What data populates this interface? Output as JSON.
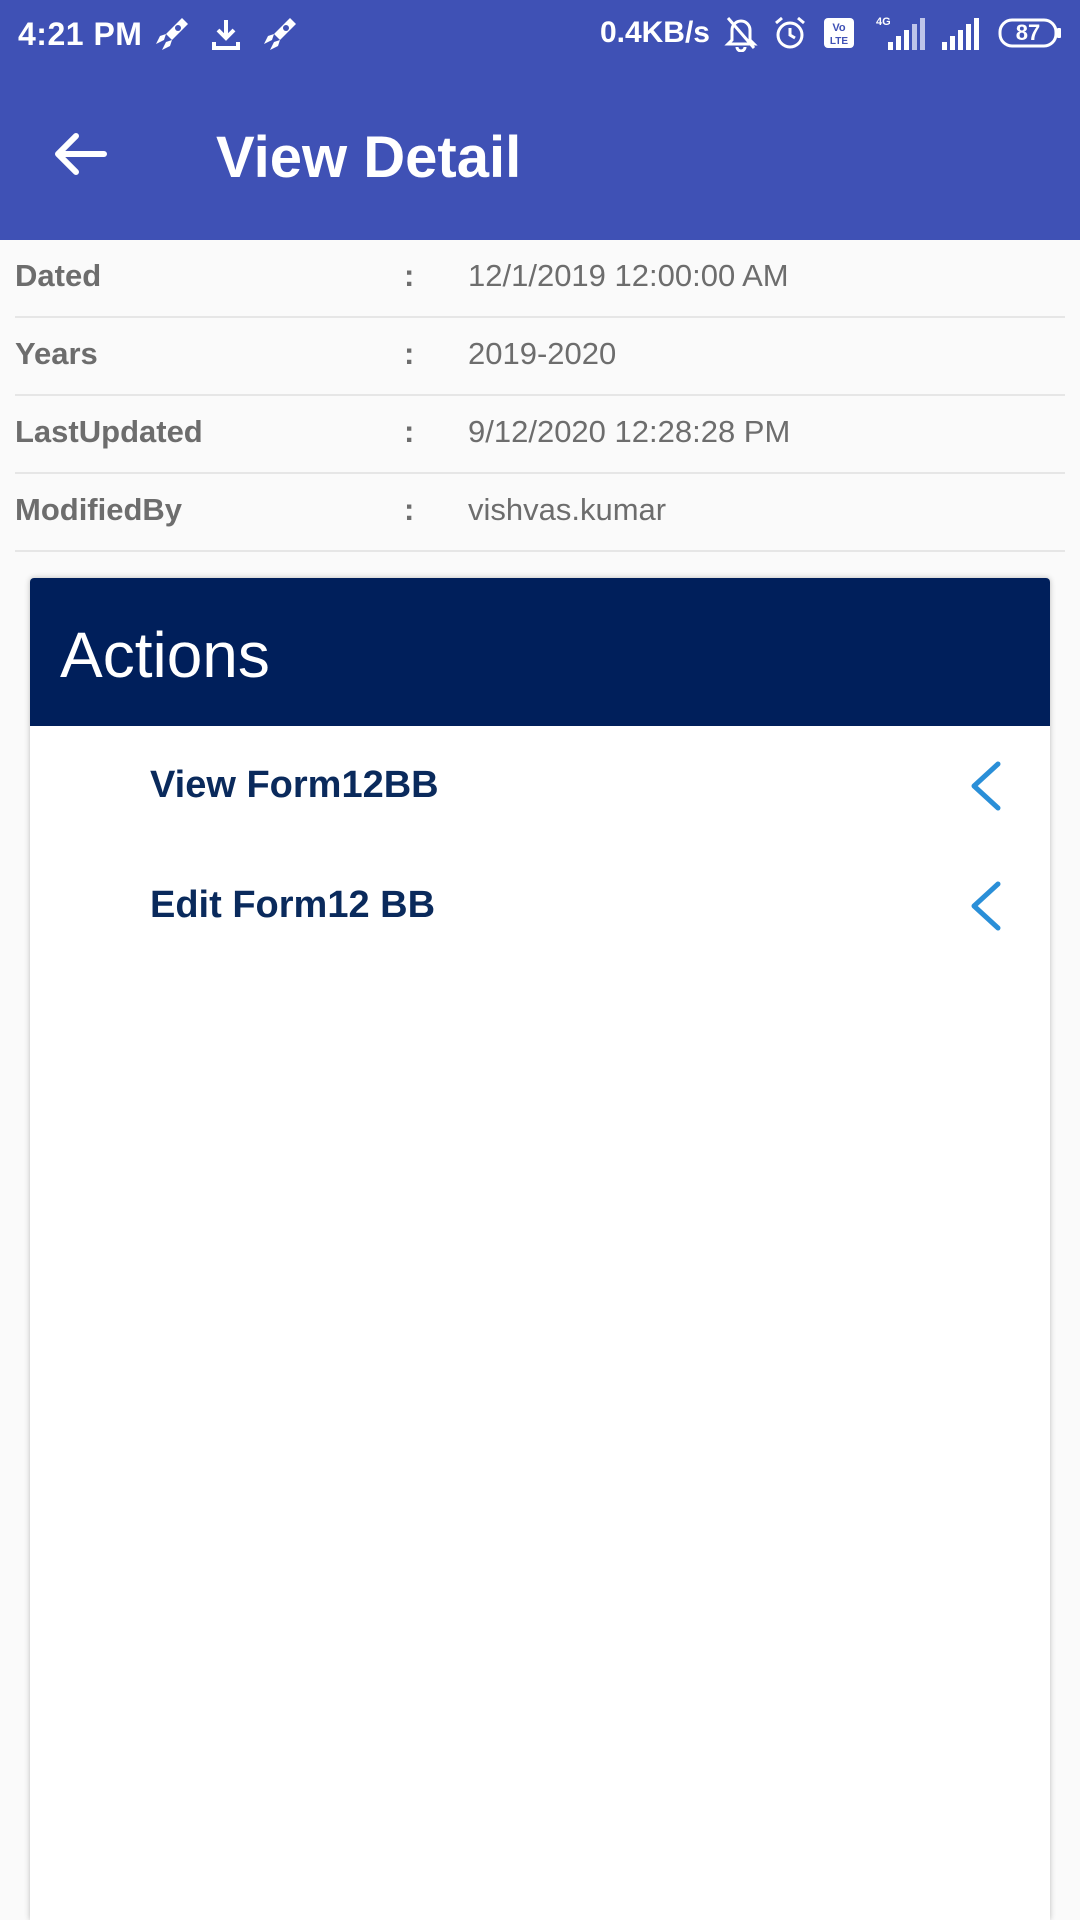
{
  "status_bar": {
    "time": "4:21 PM",
    "net_speed": "0.4KB/s",
    "battery": "87",
    "icons": [
      "rocket-icon",
      "download-icon",
      "rocket-icon",
      "bell-off-icon",
      "alarm-icon",
      "volte-icon",
      "signal-4g-icon",
      "signal-icon",
      "battery-icon"
    ]
  },
  "app_bar": {
    "title": "View Detail",
    "back_icon": "arrow-left-icon"
  },
  "details": [
    {
      "label": "Dated",
      "colon": ":",
      "value": "12/1/2019 12:00:00 AM"
    },
    {
      "label": "Years",
      "colon": ":",
      "value": "2019-2020"
    },
    {
      "label": "LastUpdated",
      "colon": ":",
      "value": "9/12/2020 12:28:28 PM"
    },
    {
      "label": "ModifiedBy",
      "colon": ":",
      "value": "vishvas.kumar"
    }
  ],
  "actions": {
    "title": "Actions",
    "items": [
      {
        "label": "View Form12BB",
        "icon": "chevron-left-icon"
      },
      {
        "label": "Edit Form12 BB",
        "icon": "chevron-left-icon"
      }
    ]
  },
  "colors": {
    "app_bar": "#3f51b5",
    "actions_header": "#001f5b",
    "action_label": "#0a2a5c",
    "chevron": "#2a8fd8"
  }
}
